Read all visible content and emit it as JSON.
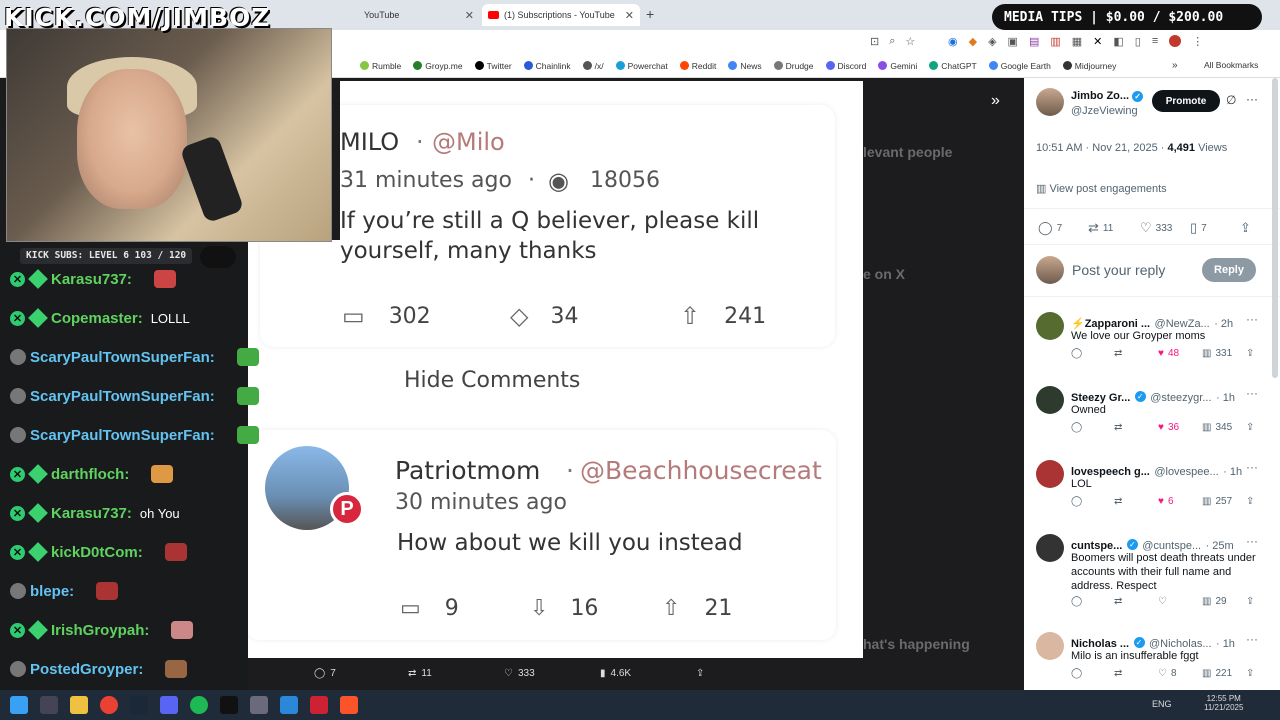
{
  "stream": {
    "title": "KICK.COM/JIMBOZ",
    "media_tips": "MEDIA TIPS | $0.00 / $200.00",
    "kick_subs": "KICK SUBS: LEVEL 6 103 / 120"
  },
  "tabs": [
    {
      "label": "YouTube"
    },
    {
      "label": "(1) Subscriptions - YouTube"
    }
  ],
  "bookmarks": [
    {
      "label": "Rumble",
      "color": "#85c742"
    },
    {
      "label": "Groyp.me",
      "color": "#2a7d2a"
    },
    {
      "label": "Twitter",
      "color": "#000000"
    },
    {
      "label": "Chainlink",
      "color": "#2a5ada"
    },
    {
      "label": "/x/",
      "color": "#555555"
    },
    {
      "label": "Powerchat",
      "color": "#1aa0d8"
    },
    {
      "label": "Reddit",
      "color": "#ff4500"
    },
    {
      "label": "News",
      "color": "#4285f4"
    },
    {
      "label": "Drudge",
      "color": "#777777"
    },
    {
      "label": "Discord",
      "color": "#5865f2"
    },
    {
      "label": "Gemini",
      "color": "#8a4de8"
    },
    {
      "label": "ChatGPT",
      "color": "#10a37f"
    },
    {
      "label": "Google Earth",
      "color": "#4285f4"
    },
    {
      "label": "Midjourney",
      "color": "#333333"
    }
  ],
  "all_bookmarks": "All Bookmarks",
  "chat": [
    {
      "user": "Karasu737:",
      "msg": "",
      "color": "#5fd35f"
    },
    {
      "user": "Copemaster:",
      "msg": "LOLLL",
      "color": "#5fd35f"
    },
    {
      "user": "ScaryPaulTownSuperFan:",
      "msg": "",
      "color": "#63c3f0"
    },
    {
      "user": "ScaryPaulTownSuperFan:",
      "msg": "",
      "color": "#63c3f0"
    },
    {
      "user": "ScaryPaulTownSuperFan:",
      "msg": "",
      "color": "#63c3f0"
    },
    {
      "user": "darthfloch:",
      "msg": "",
      "color": "#5fd35f"
    },
    {
      "user": "Karasu737:",
      "msg": "oh You",
      "color": "#5fd35f"
    },
    {
      "user": "kickD0tCom:",
      "msg": "",
      "color": "#5fd35f"
    },
    {
      "user": "blepe:",
      "msg": "",
      "color": "#63c3f0"
    },
    {
      "user": "IrishGroypah:",
      "msg": "",
      "color": "#5fd35f"
    },
    {
      "user": "PostedGroyper:",
      "msg": "",
      "color": "#63c3f0"
    }
  ],
  "post": {
    "author": "MILO",
    "sep": "·",
    "handle": "@Milo",
    "time": "31 minutes ago",
    "views": "18056",
    "text": "If you’re still a Q believer, please kill yourself, many thanks",
    "comments": "302",
    "reposts": "34",
    "upvotes": "241",
    "hide_comments": "Hide Comments"
  },
  "reply": {
    "author": "Patriotmom",
    "handle": "@Beachhousecreat",
    "time": "30 minutes ago",
    "text": "How about we kill you instead",
    "comments": "9",
    "downvotes": "16",
    "upvotes": "21"
  },
  "bottom_bar": {
    "replies": "7",
    "reposts": "11",
    "likes": "333",
    "views": "4.6K"
  },
  "x_panel": {
    "author": "Jimbo Zo...",
    "handle": "@JzeViewing",
    "promote": "Promote",
    "timestamp": "10:51 AM · Nov 21, 2025 · ",
    "views_count": "4,491",
    "views_label": "Views",
    "engagements": "View post engagements",
    "stats": {
      "replies": "7",
      "reposts": "11",
      "likes": "333",
      "bookmarks": "7"
    },
    "reply_placeholder": "Post your reply",
    "reply_button": "Reply",
    "replies": [
      {
        "name": "⚡Zapparoni ...",
        "handle": "@NewZa...",
        "time": "· 2h",
        "text": "We love our Groyper moms",
        "likes": "48",
        "views": "331",
        "liked": true,
        "verified": false
      },
      {
        "name": "Steezy Gr...",
        "handle": "@steezygr...",
        "time": "· 1h",
        "text": "Owned",
        "likes": "36",
        "views": "345",
        "liked": true,
        "verified": true
      },
      {
        "name": "lovespeech g...",
        "handle": "@lovespee...",
        "time": "· 1h",
        "text": "LOL",
        "likes": "6",
        "views": "257",
        "liked": true,
        "verified": false
      },
      {
        "name": "cuntspe...",
        "handle": "@cuntspe...",
        "time": "· 25m",
        "text": "Boomers will post death threats under accounts with their full name and address. Respect",
        "likes": "",
        "views": "29",
        "liked": false,
        "verified": true
      },
      {
        "name": "Nicholas ...",
        "handle": "@Nicholas...",
        "time": "· 1h",
        "text": "Milo is an insufferable fggt",
        "likes": "8",
        "views": "221",
        "liked": false,
        "verified": true
      }
    ]
  },
  "taskbar": {
    "lang": "ENG",
    "time": "12:55 PM",
    "date": "11/21/2025"
  }
}
